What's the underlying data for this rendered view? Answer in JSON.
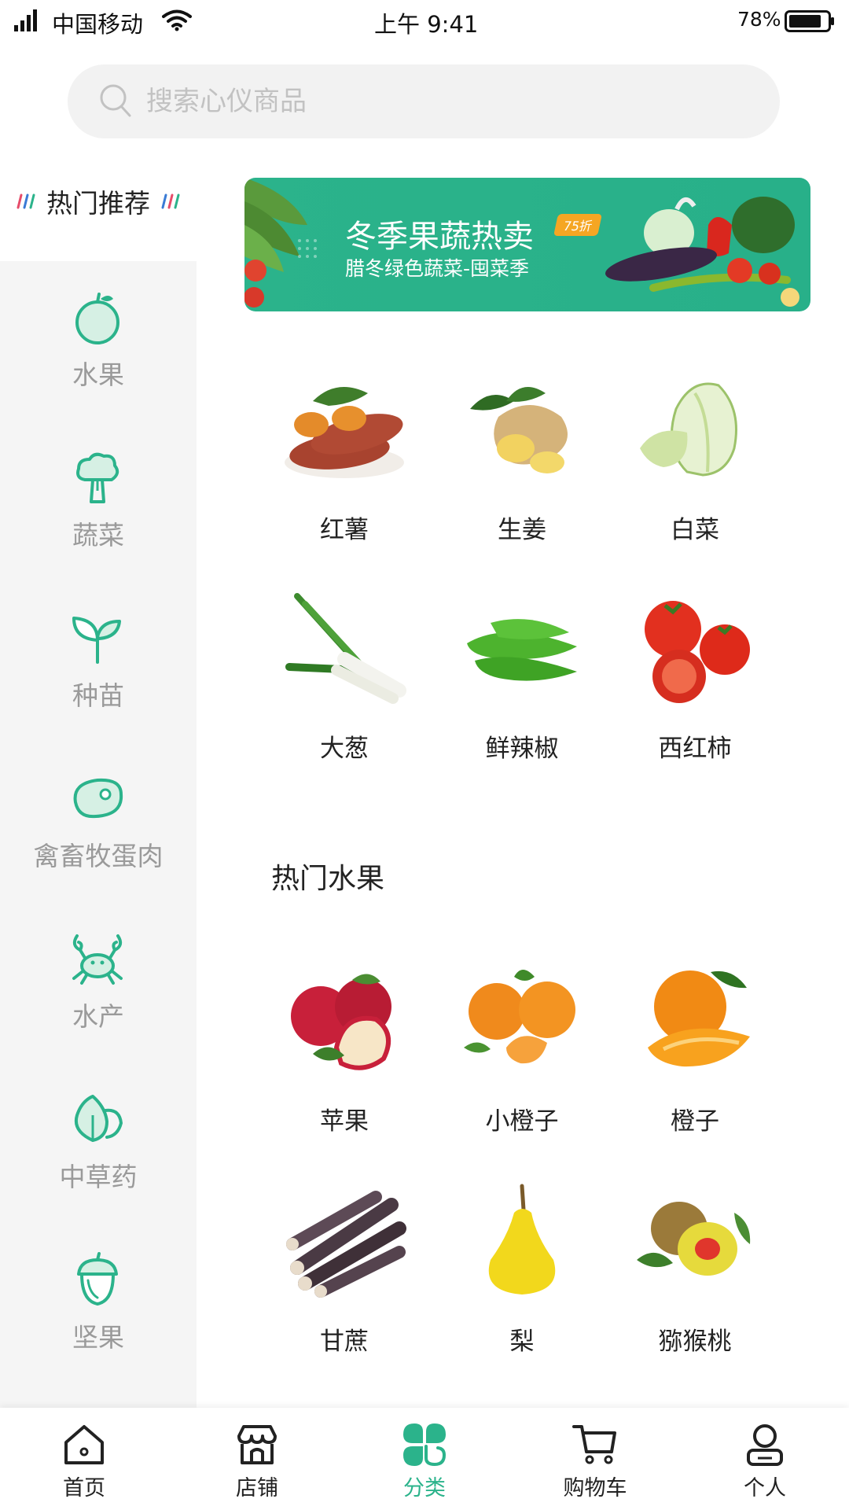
{
  "status_bar": {
    "carrier": "中国移动",
    "time": "上午 9:41",
    "battery": "78%"
  },
  "search": {
    "placeholder": "搜索心仪商品"
  },
  "sidebar": {
    "header": "热门推荐",
    "items": [
      {
        "label": "水果",
        "icon": "apple-icon"
      },
      {
        "label": "蔬菜",
        "icon": "broccoli-icon"
      },
      {
        "label": "种苗",
        "icon": "sprout-icon"
      },
      {
        "label": "禽畜牧蛋肉",
        "icon": "meat-icon"
      },
      {
        "label": "水产",
        "icon": "crab-icon"
      },
      {
        "label": "中草药",
        "icon": "leaf-icon"
      },
      {
        "label": "坚果",
        "icon": "acorn-icon"
      }
    ]
  },
  "banner": {
    "title": "冬季果蔬热卖",
    "badge": "75折",
    "subtitle": "腊冬绿色蔬菜-囤菜季"
  },
  "vegetables": [
    {
      "name": "红薯"
    },
    {
      "name": "生姜"
    },
    {
      "name": "白菜"
    },
    {
      "name": "大葱"
    },
    {
      "name": "鲜辣椒"
    },
    {
      "name": "西红柿"
    }
  ],
  "fruit_section": {
    "title": "热门水果",
    "items": [
      {
        "name": "苹果"
      },
      {
        "name": "小橙子"
      },
      {
        "name": "橙子"
      },
      {
        "name": "甘蔗"
      },
      {
        "name": "梨"
      },
      {
        "name": "猕猴桃"
      }
    ]
  },
  "tab_bar": {
    "tabs": [
      {
        "label": "首页",
        "icon": "home-icon"
      },
      {
        "label": "店铺",
        "icon": "store-icon"
      },
      {
        "label": "分类",
        "icon": "category-icon",
        "active": true
      },
      {
        "label": "购物车",
        "icon": "cart-icon"
      },
      {
        "label": "个人",
        "icon": "profile-icon"
      }
    ]
  },
  "colors": {
    "accent": "#2bb38b",
    "sidebar_bg": "#f5f5f5",
    "text_muted": "#9a9a9a"
  }
}
